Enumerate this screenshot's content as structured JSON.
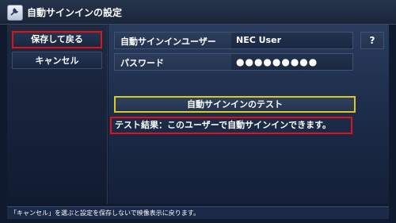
{
  "window": {
    "title": "自動サインインの設定",
    "icon": "settings-wrench-icon"
  },
  "sidebar": {
    "save_label": "保存して戻る",
    "cancel_label": "キャンセル"
  },
  "form": {
    "user_label": "自動サインインユーザー",
    "user_value": "NEC User",
    "password_label": "パスワード",
    "password_value": "●●●●●●●●●",
    "help_label": "?"
  },
  "test": {
    "button_label": "自動サインインのテスト",
    "result_text": "テスト結果：このユーザーで自動サインインできます。"
  },
  "footer": {
    "hint": "「キャンセル」を選ぶと設定を保存しないで映像表示に戻ります。"
  },
  "colors": {
    "highlight_red": "#e0121c",
    "highlight_yellow": "#d9c82a",
    "background": "#0f1a2e"
  }
}
